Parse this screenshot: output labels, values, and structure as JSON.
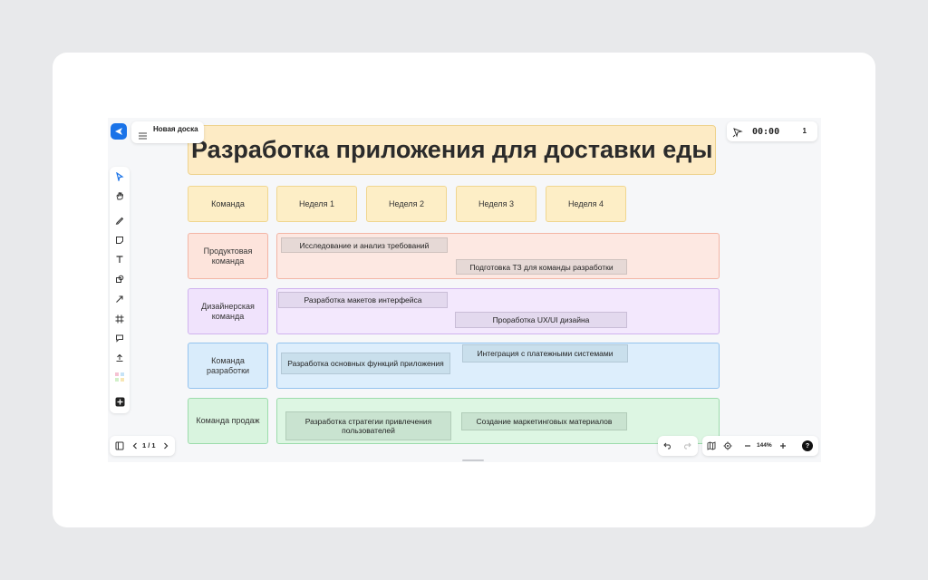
{
  "app": {
    "board_name": "Новая доска",
    "board_subtitle": "",
    "timer": "00:00",
    "participants_count": "1",
    "page_indicator": "1 / 1",
    "zoom_level": "144%",
    "help_label": "?"
  },
  "toolbar": {
    "tools": [
      "select-icon",
      "hand-icon",
      "pen-icon",
      "sticky-note-icon",
      "text-icon",
      "shapes-icon",
      "arrow-icon",
      "frame-icon",
      "comment-icon",
      "upload-icon",
      "templates-icon",
      "add-icon"
    ]
  },
  "board": {
    "title": "Разработка приложения для доставки еды",
    "header": [
      "Команда",
      "Неделя 1",
      "Неделя 2",
      "Неделя 3",
      "Неделя 4"
    ],
    "rows": [
      {
        "team": "Продуктовая команда",
        "tasks": [
          "Исследование и анализ требований",
          "Подготовка ТЗ для команды разработки"
        ]
      },
      {
        "team": "Дизайнерская команда",
        "tasks": [
          "Разработка макетов интерфейса",
          "Проработка UX/UI дизайна"
        ]
      },
      {
        "team": "Команда разработки",
        "tasks": [
          "Разработка основных функций приложения",
          "Интеграция с платежными системами"
        ]
      },
      {
        "team": "Команда продаж",
        "tasks": [
          "Разработка стратегии привлечения пользователей",
          "Создание маркетинговых материалов"
        ]
      }
    ]
  },
  "colors": {
    "accent": "#1a73e8",
    "title_bg": "#fdebc5",
    "row1": "#fde4dc",
    "row2": "#f0e3fc",
    "row3": "#d9ecfb",
    "row4": "#d9f4df"
  }
}
